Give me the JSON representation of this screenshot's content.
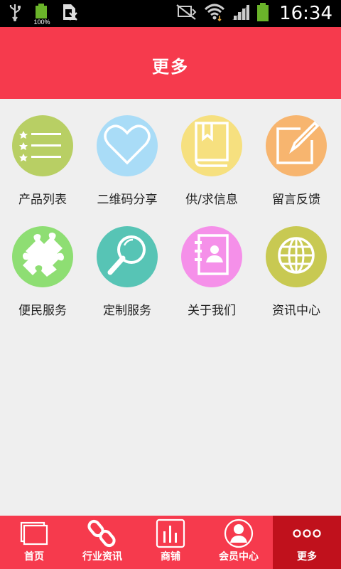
{
  "status_bar": {
    "time": "16:34",
    "battery_percent": "100%",
    "icons": [
      "usb-icon",
      "battery-icon",
      "sim-icon",
      "silent-icon",
      "wifi-icon",
      "signal-icon",
      "battery-icon"
    ]
  },
  "header": {
    "title": "更多"
  },
  "grid": {
    "items": [
      {
        "label": "产品列表",
        "icon": "product-list-icon",
        "color": "#b8cf64"
      },
      {
        "label": "二维码分享",
        "icon": "heart-icon",
        "color": "#a9dcf7"
      },
      {
        "label": "供/求信息",
        "icon": "book-icon",
        "color": "#f6e07f"
      },
      {
        "label": "留言反馈",
        "icon": "edit-icon",
        "color": "#f7b56f"
      },
      {
        "label": "便民服务",
        "icon": "puzzle-icon",
        "color": "#8ede73"
      },
      {
        "label": "定制服务",
        "icon": "search-icon",
        "color": "#57c4b5"
      },
      {
        "label": "关于我们",
        "icon": "contact-book-icon",
        "color": "#f590e9"
      },
      {
        "label": "资讯中心",
        "icon": "globe-icon",
        "color": "#c8c952"
      }
    ]
  },
  "bottom_nav": {
    "items": [
      {
        "label": "首页",
        "icon": "home-icon"
      },
      {
        "label": "行业资讯",
        "icon": "link-icon"
      },
      {
        "label": "商铺",
        "icon": "chart-icon"
      },
      {
        "label": "会员中心",
        "icon": "user-icon"
      },
      {
        "label": "更多",
        "icon": "more-icon"
      }
    ],
    "active_index": 4
  },
  "colors": {
    "header": "#f63a4d",
    "nav_active": "#c0111c",
    "background": "#efefef"
  }
}
